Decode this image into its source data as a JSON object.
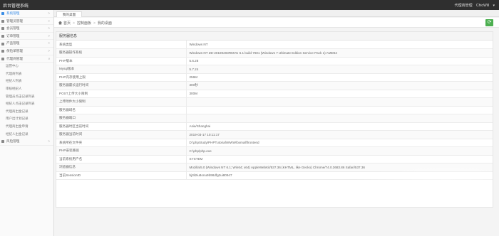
{
  "app": {
    "title": "后台管理系统"
  },
  "header": {
    "user_role": "代理商管理",
    "username": "ChicWill"
  },
  "sidebar": {
    "items": [
      {
        "label": "系统管理",
        "active": true
      },
      {
        "label": "管理员管理"
      },
      {
        "label": "会员管理"
      },
      {
        "label": "订单管理"
      },
      {
        "label": "产品管理"
      },
      {
        "label": "保险单管理"
      },
      {
        "label": "代理商管理"
      }
    ],
    "sub_items": [
      "运营中心",
      "代理商列表",
      "经纪人列表",
      "审核经纪人",
      "管理员点击记录列表",
      "经纪人点击记录列表",
      "代理商出金记录",
      "用户出计划记录",
      "代理商出金申请",
      "经纪人出金记录"
    ],
    "bottom_item": {
      "label": "风险管理"
    }
  },
  "tabs": [
    {
      "label": "我的桌面"
    }
  ],
  "breadcrumb": {
    "home": "首页",
    "level1": "控制面板",
    "level2": "我的桌面"
  },
  "panel": {
    "title": "服务器信息",
    "rows": [
      {
        "key": "系统类型",
        "value": "Windows NT"
      },
      {
        "key": "服务器操作系统",
        "value": "Windows NT ZD-20190203RMVU 6.1 build 7601 (Windows 7 Ultimate Edition Service Pack 1) AMD64"
      },
      {
        "key": "PHP版本",
        "value": "5.6.28"
      },
      {
        "key": "Mysql版本",
        "value": "5.7.24"
      },
      {
        "key": "PHP内存使用上限",
        "value": "256M"
      },
      {
        "key": "服务器最长运行时间",
        "value": "300秒"
      },
      {
        "key": "POST上传大小限制",
        "value": "300M"
      },
      {
        "key": "上传附件大小限制",
        "value": ""
      },
      {
        "key": "服务器域名",
        "value": ""
      },
      {
        "key": "服务器端口",
        "value": ""
      },
      {
        "key": "服务器时区当前时间",
        "value": "Asia/Shanghai"
      },
      {
        "key": "服务器当前时间",
        "value": "2019-03-17 10:11:17"
      },
      {
        "key": "系统所在文件夹",
        "value": "D:\\phpStudy\\PHPTutorial\\WWW\\bxmall\\frontend"
      },
      {
        "key": "PHP安装路径",
        "value": "C:\\php\\php.exe"
      },
      {
        "key": "当前系统用户名",
        "value": "SYSTEM"
      },
      {
        "key": "浏览器信息",
        "value": "Mozilla/5.0 (Windows NT 6.1; Win64; x64) AppleWebKit/537.36 (KHTML, like Gecko) Chrome/74.0.3683.86 Safari/537.36"
      },
      {
        "key": "当前SessionID",
        "value": "bj3li2iu8onu9b98dfg2ui80947"
      }
    ]
  },
  "icons": {
    "refresh": "refresh-icon",
    "home": "home-icon",
    "menu": "menu-icon",
    "chevron": "chevron-icon"
  },
  "colors": {
    "accent": "#3c8ee6",
    "topbar": "#2f2f2f",
    "refresh_button": "#4caf50"
  }
}
